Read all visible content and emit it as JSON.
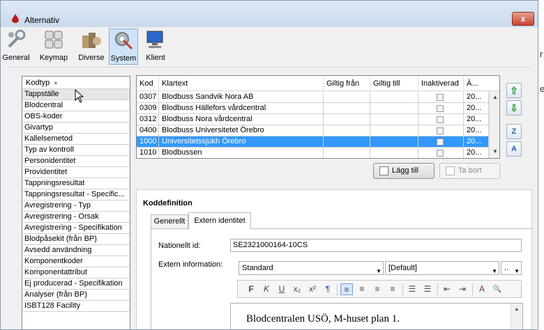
{
  "window": {
    "title": "Alternativ",
    "close": "x"
  },
  "toolbar": {
    "items": [
      {
        "label": "General",
        "icon": "wrench-icon"
      },
      {
        "label": "Keymap",
        "icon": "keyboard-icon"
      },
      {
        "label": "Diverse",
        "icon": "misc-icon"
      },
      {
        "label": "System",
        "icon": "system-gear-icon",
        "selected": true
      },
      {
        "label": "Klient",
        "icon": "computer-icon"
      }
    ]
  },
  "left_list": {
    "header": "Kodtyp",
    "sort_indicator": "▲",
    "items": [
      "Tappställe",
      "Blodcentral",
      "OBS-koder",
      "Givartyp",
      "Kallelsemetod",
      "Typ av kontroll",
      "Personidentitet",
      "Providentitet",
      "Tappningsresultat",
      "Tappningsresultat - Specific...",
      "Avregistrering - Typ",
      "Avregistrering - Orsak",
      "Avregistrering - Specifikation",
      "Blodpåsekit (från BP)",
      "Avsedd användning",
      "Komponentkoder",
      "Komponentattribut",
      "Ej producerad - Specifikation",
      "Analyser (från BP)",
      "ISBT128 Facility"
    ],
    "selected_index": 0
  },
  "grid": {
    "columns": [
      "Kod",
      "Klartext",
      "Giltig från",
      "Giltig till",
      "Inaktiverad",
      "Ä..."
    ],
    "rows": [
      {
        "kod": "0307",
        "klartext": "Blodbuss Sandvik Nora AB",
        "giltig_fran": "",
        "giltig_till": "",
        "inaktiverad": false,
        "a": "20..."
      },
      {
        "kod": "0309",
        "klartext": "Blodbuss Hällefors vårdcentral",
        "giltig_fran": "",
        "giltig_till": "",
        "inaktiverad": false,
        "a": "20..."
      },
      {
        "kod": "0312",
        "klartext": "Blodbuss Nora vårdcentral",
        "giltig_fran": "",
        "giltig_till": "",
        "inaktiverad": false,
        "a": "20..."
      },
      {
        "kod": "0400",
        "klartext": "Blodbuss Universitetet Örebro",
        "giltig_fran": "",
        "giltig_till": "",
        "inaktiverad": false,
        "a": "20..."
      },
      {
        "kod": "1000",
        "klartext": "Universitetssjukh Örebro",
        "giltig_fran": "",
        "giltig_till": "",
        "inaktiverad": false,
        "a": "20...",
        "selected": true
      },
      {
        "kod": "1010",
        "klartext": "Blodbussen",
        "giltig_fran": "",
        "giltig_till": "",
        "inaktiverad": false,
        "a": "20..."
      }
    ]
  },
  "side_buttons": {
    "up": "⇧",
    "down": "⇩",
    "sort_desc": "Z",
    "sort_asc": "A"
  },
  "actions": {
    "add_label": "Lägg till",
    "remove_label": "Ta bort"
  },
  "koddefinition": {
    "title": "Koddefinition",
    "tabs": [
      "Generellt",
      "Extern identitet"
    ],
    "active_tab": 1,
    "national_id_label": "Nationellt id:",
    "national_id_value": "SE2321000164-10CS",
    "external_info_label": "Extern information:",
    "style_select": "Standard",
    "font_select": "[Default]",
    "size_select": "..",
    "format_buttons": [
      "F",
      "K",
      "U",
      "x₂",
      "x²",
      "¶",
      "≡",
      "≡",
      "≡",
      "≡",
      "☰",
      "☰",
      "⇤",
      "⇥",
      "A",
      "🔍"
    ],
    "editor_text": "Blodcentralen USÖ, M-huset plan 1."
  },
  "background_fragments": [
    "r",
    "e"
  ]
}
